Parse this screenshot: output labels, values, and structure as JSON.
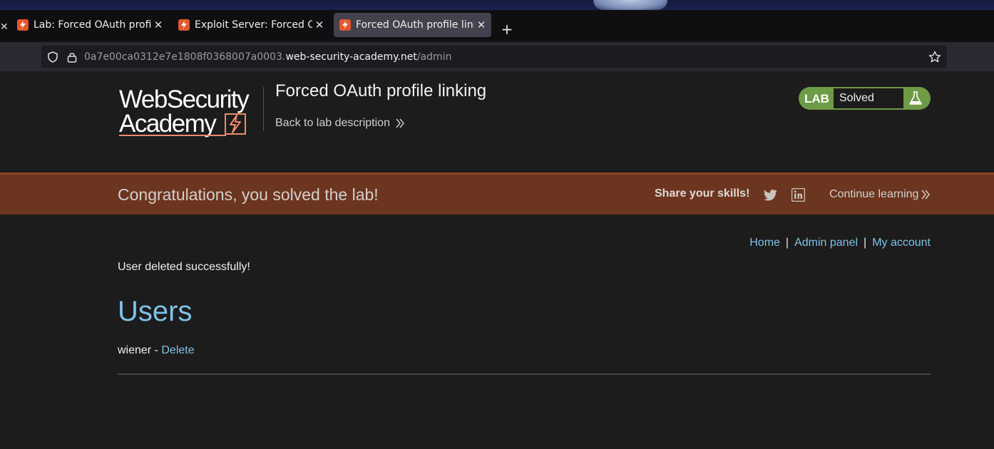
{
  "browser": {
    "tabs": [
      {
        "title": "Lab: Forced OAuth profile linking",
        "active": false
      },
      {
        "title": "Exploit Server: Forced OAuth profile linking",
        "active": false
      },
      {
        "title": "Forced OAuth profile linking",
        "active": true
      }
    ],
    "url": {
      "prefix": "0a7e00ca0312e7e1808f0368007a0003.",
      "host": "web-security-academy.net",
      "path": "/admin"
    }
  },
  "header": {
    "logo_line1": "WebSecurity",
    "logo_line2": "Academy",
    "lab_title": "Forced OAuth profile linking",
    "back_link": "Back to lab description",
    "status_label": "LAB",
    "status_value": "Solved"
  },
  "banner": {
    "message": "Congratulations, you solved the lab!",
    "share": "Share your skills!",
    "continue": "Continue learning"
  },
  "nav": {
    "home": "Home",
    "sep": "|",
    "admin": "Admin panel",
    "account": "My account"
  },
  "main": {
    "message": "User deleted successfully!",
    "heading": "Users",
    "users": [
      {
        "name": "wiener",
        "separator": " - ",
        "action": "Delete"
      }
    ]
  },
  "colors": {
    "accent": "#7fc2e8",
    "banner": "#6c351f",
    "lab_badge": "#6e9b46",
    "background": "#1c1c1c"
  }
}
